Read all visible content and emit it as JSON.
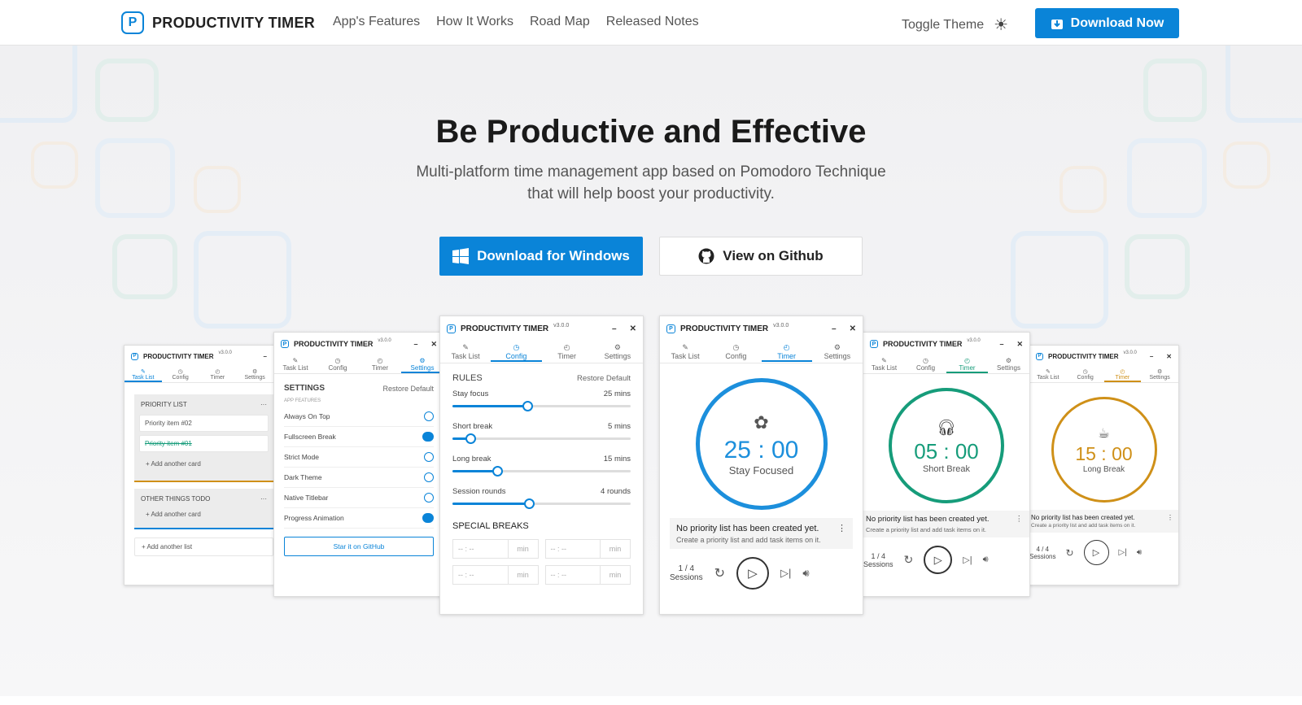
{
  "nav": {
    "logo_letter": "P",
    "brand": "PRODUCTIVITY TIMER",
    "links": [
      "App's Features",
      "How It Works",
      "Road Map",
      "Released Notes"
    ],
    "toggle_theme": "Toggle Theme",
    "download_now": "Download Now"
  },
  "hero": {
    "title": "Be Productive and Effective",
    "subtitle_line1": "Multi-platform time management app based on Pomodoro Technique",
    "subtitle_line2": "that will help boost your productivity.",
    "btn_windows": "Download for Windows",
    "btn_github": "View on Github"
  },
  "app": {
    "title": "PRODUCTIVITY TIMER",
    "version": "v3.0.0",
    "tabs": [
      "Task List",
      "Config",
      "Timer",
      "Settings"
    ]
  },
  "tasklist": {
    "priority_title": "PRIORITY LIST",
    "items": [
      "Priority item #02",
      "Priority item #01"
    ],
    "add_card": "Add another card",
    "other_title": "OTHER THINGS TODO",
    "add_list": "Add another list"
  },
  "settings": {
    "title": "SETTINGS",
    "restore": "Restore Default",
    "section": "APP FEATURES",
    "rows": [
      {
        "label": "Always On Top",
        "on": false
      },
      {
        "label": "Fullscreen Break",
        "on": true
      },
      {
        "label": "Strict Mode",
        "on": false
      },
      {
        "label": "Dark Theme",
        "on": false
      },
      {
        "label": "Native Titlebar",
        "on": false
      },
      {
        "label": "Progress Animation",
        "on": true
      }
    ],
    "star": "Star it on GitHub"
  },
  "config": {
    "rules_title": "RULES",
    "restore": "Restore Default",
    "rules": [
      {
        "label": "Stay focus",
        "value": "25 mins",
        "level": 0.42
      },
      {
        "label": "Short break",
        "value": "5 mins",
        "level": 0.1
      },
      {
        "label": "Long break",
        "value": "15 mins",
        "level": 0.25
      },
      {
        "label": "Session rounds",
        "value": "4 rounds",
        "level": 0.43
      }
    ],
    "special_title": "SPECIAL BREAKS",
    "time_placeholder": "-- : --",
    "min_label": "min"
  },
  "timers": [
    {
      "time": "25 : 00",
      "label": "Stay Focused",
      "color": "#1c8fdc",
      "icon": "focus-icon",
      "sessions": "1 / 4",
      "sessions_label": "Sessions"
    },
    {
      "time": "05 : 00",
      "label": "Short Break",
      "color": "#169c7a",
      "icon": "headphones-icon",
      "sessions": "1 / 4",
      "sessions_label": "Sessions"
    },
    {
      "time": "15 : 00",
      "label": "Long Break",
      "color": "#cf9018",
      "icon": "coffee-icon",
      "sessions": "4 / 4",
      "sessions_label": "Sessions"
    }
  ],
  "priority_notice": {
    "title": "No priority list has been created yet.",
    "hint": "Create a priority list and add task items on it."
  },
  "colors": {
    "accent": "#0a84d8"
  }
}
